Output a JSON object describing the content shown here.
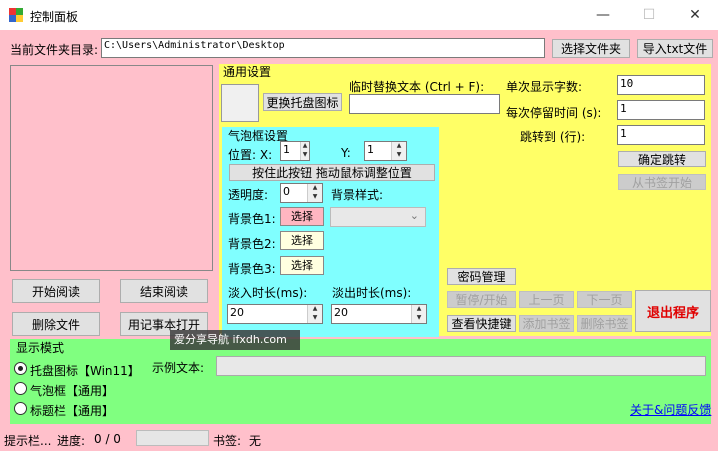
{
  "window": {
    "title": "控制面板",
    "min": "—",
    "max": "☐",
    "close": "✕"
  },
  "top": {
    "dir_label": "当前文件夹目录:",
    "dir_value": "C:\\Users\\Administrator\\Desktop",
    "choose_folder": "选择文件夹",
    "import_txt": "导入txt文件"
  },
  "left_buttons": {
    "start_read": "开始阅读",
    "end_read": "结束阅读",
    "delete_file": "删除文件",
    "notepad_open": "用记事本打开"
  },
  "general": {
    "title": "通用设置",
    "change_tray_icon": "更换托盘图标",
    "temp_replace_label": "临时替换文本 (Ctrl + F):",
    "temp_replace_value": "",
    "single_display_label": "单次显示字数:",
    "single_display_value": "10",
    "dwell_label": "每次停留时间 (s):",
    "dwell_value": "1",
    "jump_label": "跳转到 (行):",
    "jump_value": "1",
    "confirm_jump": "确定跳转",
    "from_bookmark": "从书签开始",
    "password_mgmt": "密码管理",
    "pause_start": "暂停/开始",
    "prev_page": "上一页",
    "next_page": "下一页",
    "view_shortcuts": "查看快捷键",
    "add_bookmark": "添加书签",
    "delete_bookmark": "删除书签",
    "exit": "退出程序"
  },
  "bubble": {
    "title": "气泡框设置",
    "pos_label": "位置: X:",
    "x_value": "1",
    "y_label": "Y:",
    "y_value": "1",
    "drag_button": "按住此按钮 拖动鼠标调整位置",
    "opacity_label": "透明度:",
    "opacity_value": "0",
    "bg_style_label": "背景样式:",
    "bg1_label": "背景色1:",
    "bg2_label": "背景色2:",
    "bg3_label": "背景色3:",
    "choose": "选择",
    "fade_in_label": "淡入时长(ms):",
    "fade_in_value": "20",
    "fade_out_label": "淡出时长(ms):",
    "fade_out_value": "20",
    "bg1_color": "#ffb6c1",
    "bg2_color": "#ffffe0",
    "bg3_color": "#ffffe0"
  },
  "display": {
    "title": "显示模式",
    "opt1": "托盘图标【Win11】",
    "opt2": "气泡框【通用】",
    "opt3": "标题栏【通用】",
    "sample_label": "示例文本:",
    "sample_value": "",
    "about_link": "关于&问题反馈"
  },
  "watermark": "爱分享导航 ifxdh.com",
  "status": {
    "hint": "提示栏...",
    "progress_label": "进度:",
    "progress_value": "0 / 0",
    "bookmark_label": "书签:",
    "bookmark_value": "无"
  }
}
